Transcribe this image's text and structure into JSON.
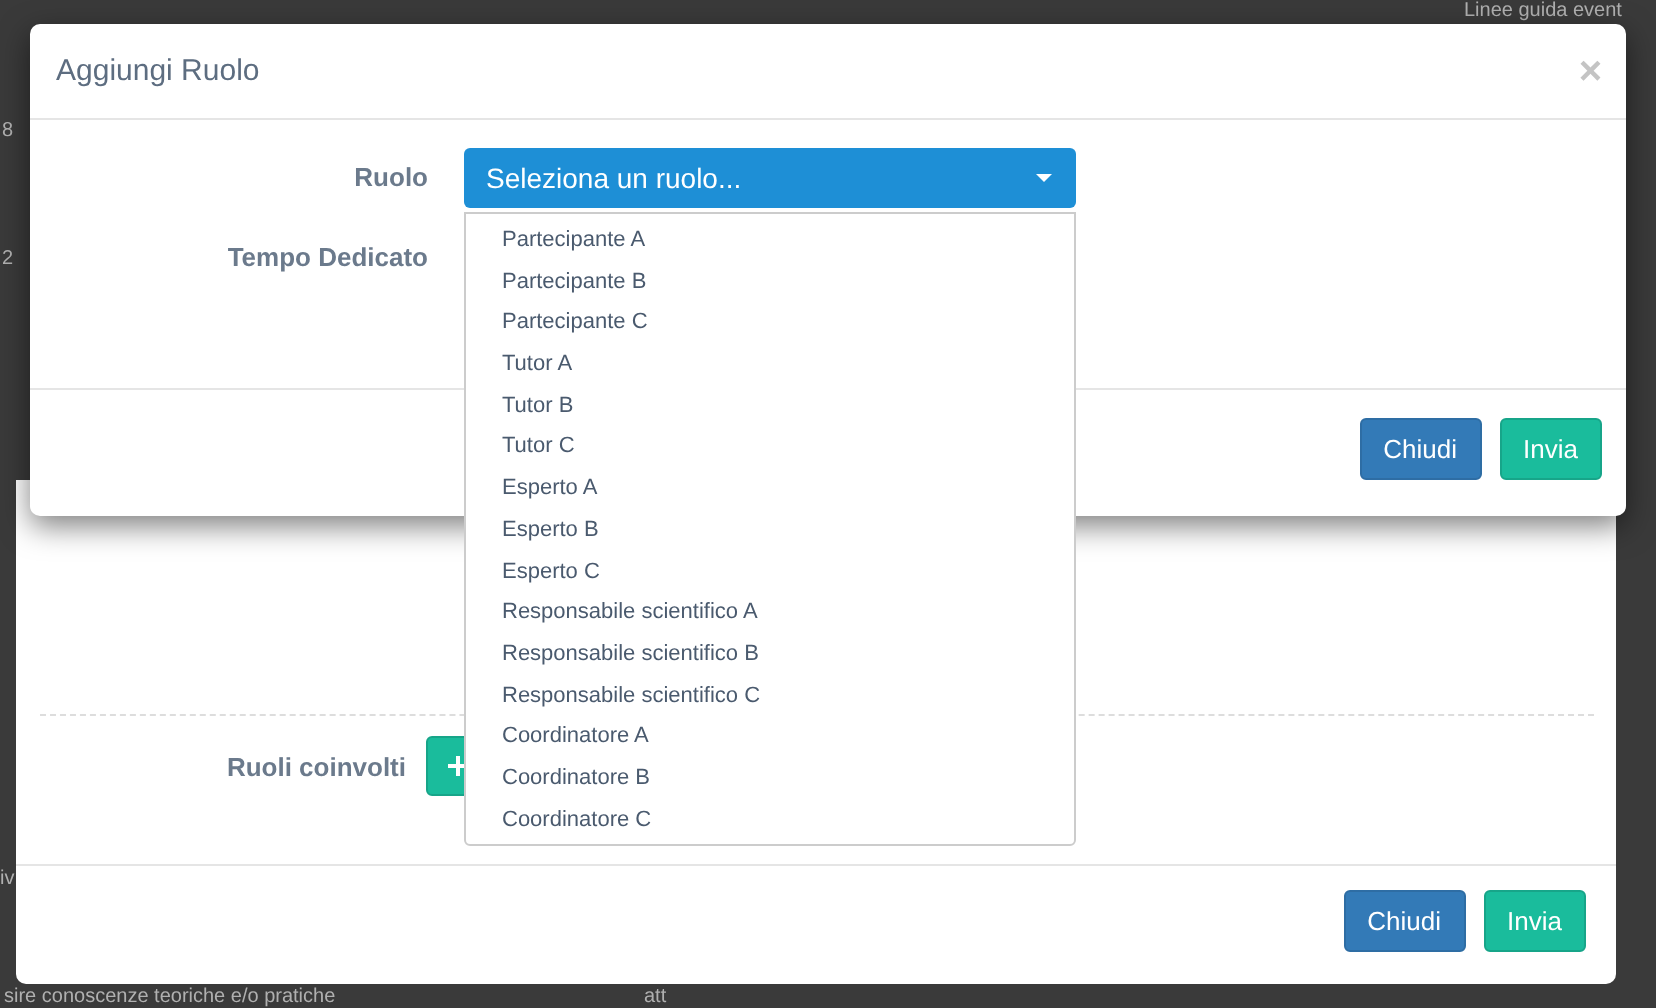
{
  "background_page": {
    "fragments": [
      "Linee guida event",
      "8",
      "2",
      "iv",
      "sire conoscenze teoriche e/o pratiche",
      "att"
    ]
  },
  "back_dialog": {
    "fields": [
      {
        "label": "Ruoli coinvolti",
        "kind": "add"
      }
    ],
    "buttons": [
      {
        "label": "Chiudi",
        "kind": "primary"
      },
      {
        "label": "Invia",
        "kind": "success"
      }
    ]
  },
  "dialog": {
    "title": "Aggiungi Ruolo",
    "close": "×",
    "fields": [
      {
        "label": "Ruolo",
        "kind": "select",
        "value": "Seleziona un ruolo...",
        "expanded": true,
        "options": [
          "Partecipante A",
          "Partecipante B",
          "Partecipante C",
          "Tutor A",
          "Tutor B",
          "Tutor C",
          "Esperto A",
          "Esperto B",
          "Esperto C",
          "Responsabile scientifico A",
          "Responsabile scientifico B",
          "Responsabile scientifico C",
          "Coordinatore A",
          "Coordinatore B",
          "Coordinatore C"
        ]
      },
      {
        "label": "Tempo Dedicato",
        "kind": "text"
      }
    ],
    "buttons": [
      {
        "label": "Chiudi",
        "kind": "primary"
      },
      {
        "label": "Invia",
        "kind": "success"
      }
    ]
  }
}
